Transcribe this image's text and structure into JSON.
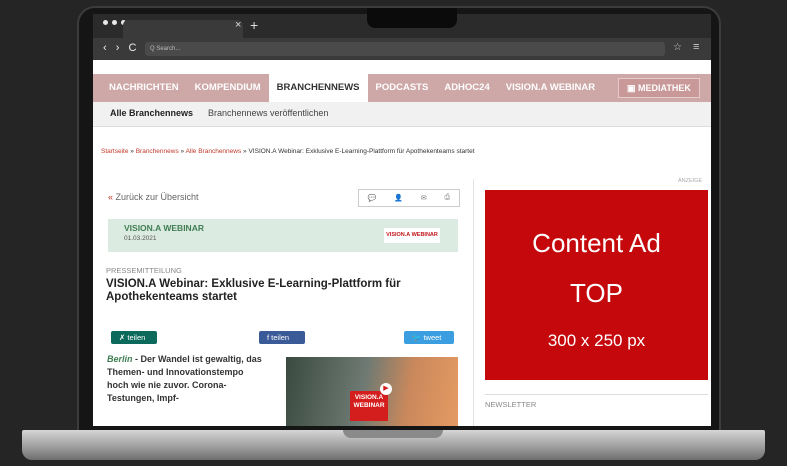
{
  "browser": {
    "tab_close": "×",
    "tab_new": "+",
    "nav_controls": "‹ › C",
    "search_placeholder": "Q Search...",
    "star_icon": "☆",
    "menu_icon": "≡"
  },
  "site_nav": {
    "items": [
      "NACHRICHTEN",
      "KOMPENDIUM",
      "BRANCHENNEWS",
      "PODCASTS",
      "ADHOC24",
      "VISION.A WEBINAR"
    ],
    "mediathek": "MEDIATHEK"
  },
  "sub_nav": {
    "active": "Alle Branchennews",
    "other": "Branchennews veröffentlichen"
  },
  "breadcrumb": {
    "items": [
      "Startseite",
      "Branchennews",
      "Alle Branchennews"
    ],
    "current": "VISION.A Webinar: Exklusive E-Learning-Plattform für Apothekenteams startet"
  },
  "article": {
    "back": "Zurück zur Übersicht",
    "category": "VISION.A WEBINAR",
    "date": "01.03.2021",
    "category_logo": "VISION.A WEBINAR",
    "type": "PRESSEMITTEILUNG",
    "headline": "VISION.A Webinar: Exklusive E-Learning-Plattform für Apothekenteams startet",
    "share_x": "teilen",
    "share_fb": "teilen",
    "share_tw": "tweet",
    "city": "Berlin",
    "lead": " - Der Wandel ist gewaltig, das Themen- und Innovationstempo hoch wie nie zuvor. Corona-Testungen, Impf-",
    "video_badge": "VISION.A WEBINAR"
  },
  "sidebar": {
    "anzeige": "ANZEIGE",
    "ad_line1": "Content Ad",
    "ad_line2": "TOP",
    "ad_line3": "300 x 250 px",
    "newsletter": "NEWSLETTER"
  }
}
